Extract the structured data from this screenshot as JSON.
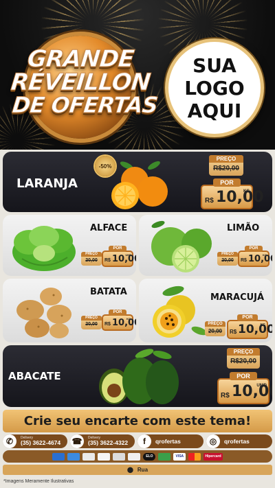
{
  "header": {
    "title_lines": [
      "GRANDE",
      "RÉVEILLON",
      "DE OFERTAS"
    ],
    "logo_lines": [
      "SUA",
      "LOGO",
      "AQUI"
    ]
  },
  "products": {
    "laranja": {
      "name": "LARANJA",
      "badge": "-50%",
      "old_label": "PREÇO",
      "old_price": "R$20,00",
      "new_label": "POR",
      "currency": "R$",
      "price": "10,00",
      "unit": "KG"
    },
    "alface": {
      "name": "ALFACE",
      "old_label": "PREÇO",
      "old_price": "20,00",
      "new_label": "POR",
      "currency": "R$",
      "price": "10,00",
      "unit": "UND"
    },
    "limao": {
      "name": "LIMÃO",
      "old_label": "PREÇO",
      "old_price": "20,00",
      "new_label": "POR",
      "currency": "R$",
      "price": "10,00",
      "unit": "KG"
    },
    "batata": {
      "name": "BATATA",
      "old_label": "PREÇO",
      "old_price": "20,00",
      "new_label": "POR",
      "currency": "R$",
      "price": "10,00",
      "unit": "KG"
    },
    "maracuja": {
      "name": "MARACUJÁ",
      "old_label": "PREÇO",
      "old_price": "20,00",
      "new_label": "POR",
      "currency": "R$",
      "price": "10,00",
      "unit": "KG"
    },
    "abacate": {
      "name": "ABACATE",
      "old_label": "PREÇO",
      "old_price": "R$20,00",
      "new_label": "POR",
      "currency": "R$",
      "price": "10,00",
      "unit": "UNID"
    }
  },
  "cta": "Crie seu encarte com este tema!",
  "contacts": {
    "whatsapp": {
      "small": "Delivery",
      "value": "(35) 3622-4674",
      "icon": "whatsapp-icon"
    },
    "phone": {
      "small": "Delivery",
      "value": "(35) 3622-4322",
      "icon": "phone-icon"
    },
    "facebook": {
      "value": "qrofertas",
      "icon": "facebook-icon"
    },
    "instagram": {
      "value": "qrofertas",
      "icon": "instagram-icon"
    }
  },
  "payments": [
    "",
    "",
    "",
    "",
    "",
    "",
    "ELO",
    "",
    "VISA",
    "",
    "Hipercard"
  ],
  "address": "Rua",
  "disclaimer": "*Imagens Meramente Ilustrativas",
  "colors": {
    "gold": "#d89a47",
    "dark_card": "#1e1e26",
    "brown": "#7b4a1c"
  }
}
